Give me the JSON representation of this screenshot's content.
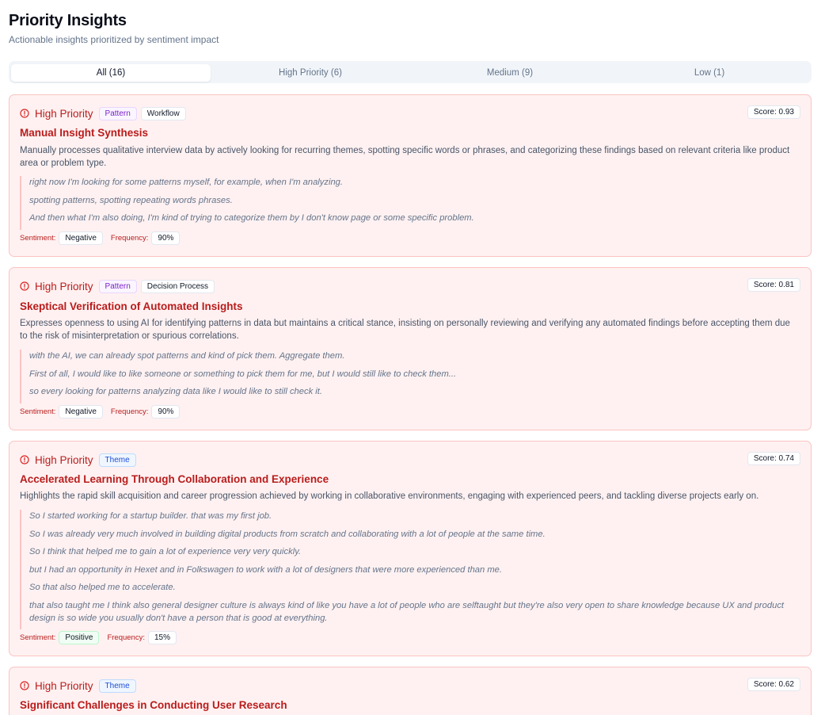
{
  "header": {
    "title": "Priority Insights",
    "subtitle": "Actionable insights prioritized by sentiment impact"
  },
  "tabs": [
    {
      "label": "All (16)",
      "active": true
    },
    {
      "label": "High Priority (6)",
      "active": false
    },
    {
      "label": "Medium (9)",
      "active": false
    },
    {
      "label": "Low (1)",
      "active": false
    }
  ],
  "cards": [
    {
      "priority": "High Priority",
      "tags": [
        "Pattern",
        "Workflow"
      ],
      "score": "Score: 0.93",
      "title": "Manual Insight Synthesis",
      "description": "Manually processes qualitative interview data by actively looking for recurring themes, spotting specific words or phrases, and categorizing these findings based on relevant criteria like product area or problem type.",
      "quotes": [
        "right now I'm looking for some patterns myself, for example, when I'm analyzing.",
        "spotting patterns, spotting repeating words phrases.",
        "And then what I'm also doing, I'm kind of trying to categorize them by I don't know page or some specific problem."
      ],
      "sentiment_label": "Sentiment:",
      "sentiment": "Negative",
      "frequency_label": "Frequency:",
      "frequency": "90%"
    },
    {
      "priority": "High Priority",
      "tags": [
        "Pattern",
        "Decision Process"
      ],
      "score": "Score: 0.81",
      "title": "Skeptical Verification of Automated Insights",
      "description": "Expresses openness to using AI for identifying patterns in data but maintains a critical stance, insisting on personally reviewing and verifying any automated findings before accepting them due to the risk of misinterpretation or spurious correlations.",
      "quotes": [
        "with the AI, we can already spot patterns and kind of pick them. Aggregate them.",
        "First of all, I would like to like someone or something to pick them for me, but I would still like to check them...",
        "so every looking for patterns analyzing data like I would like to still check it."
      ],
      "sentiment_label": "Sentiment:",
      "sentiment": "Negative",
      "frequency_label": "Frequency:",
      "frequency": "90%"
    },
    {
      "priority": "High Priority",
      "tags": [
        "Theme"
      ],
      "score": "Score: 0.74",
      "title": "Accelerated Learning Through Collaboration and Experience",
      "description": "Highlights the rapid skill acquisition and career progression achieved by working in collaborative environments, engaging with experienced peers, and tackling diverse projects early on.",
      "quotes": [
        "So I started working for a startup builder. that was my first job.",
        "So I was already very much involved in building digital products from scratch and collaborating with a lot of people at the same time.",
        "So I think that helped me to gain a lot of experience very very quickly.",
        "but I had an opportunity in Hexet and in Folkswagen to work with a lot of designers that were more experienced than me.",
        "So that also helped me to accelerate.",
        "that also taught me I think also general designer culture is always kind of like you have a lot of people who are selftaught but they're also very open to share knowledge because UX and product design is so wide you usually don't have a person that is good at everything."
      ],
      "sentiment_label": "Sentiment:",
      "sentiment": "Positive",
      "frequency_label": "Frequency:",
      "frequency": "15%"
    },
    {
      "priority": "High Priority",
      "tags": [
        "Theme"
      ],
      "score": "Score: 0.62",
      "title": "Significant Challenges in Conducting User Research"
    }
  ]
}
